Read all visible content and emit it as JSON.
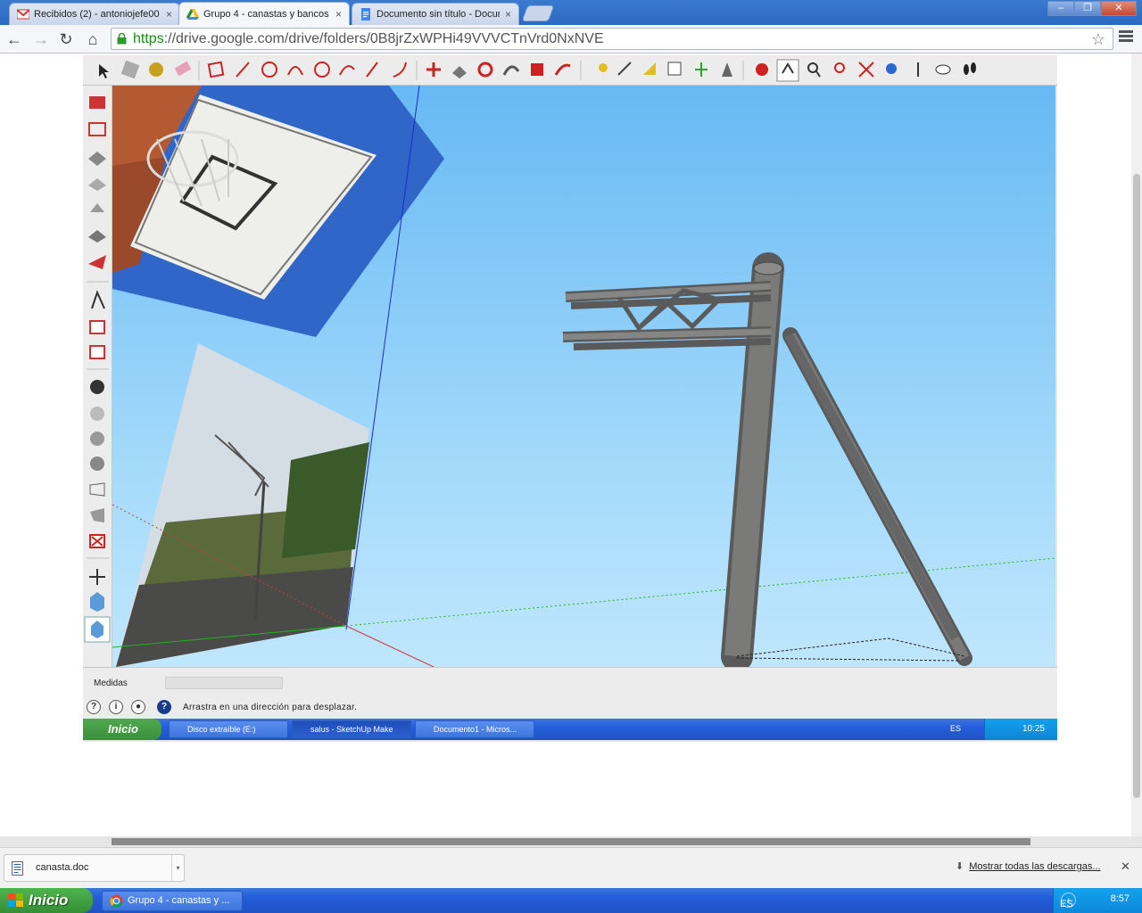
{
  "browser": {
    "tabs": [
      {
        "label": "Recibidos (2) - antoniojefe00",
        "close": "×",
        "icon": "gmail-icon"
      },
      {
        "label": "Grupo 4 - canastas y bancos",
        "close": "×",
        "icon": "google-drive-icon"
      },
      {
        "label": "Documento sin título - Docum",
        "close": "×",
        "icon": "google-docs-icon"
      }
    ],
    "window_buttons": {
      "minimize": "–",
      "maximize": "❐",
      "close": "✕"
    },
    "nav": {
      "back": "←",
      "forward": "→",
      "reload": "↻",
      "home": "⌂"
    },
    "url_scheme": "https",
    "url_rest": "://drive.google.com/drive/folders/0B8jrZxWPHi49VVVCTnVrd0NxNVE",
    "bookmark_star": "☆"
  },
  "sketchup": {
    "measurements_label": "Medidas",
    "measurements_value": "",
    "status_hint": "Arrastra en una dirección para desplazar.",
    "status_icons": [
      "?",
      "i",
      "●",
      "?"
    ],
    "inner_taskbar": {
      "start": "Inicio",
      "buttons": [
        {
          "label": "Disco extraíble (E:)"
        },
        {
          "label": "salus - SketchUp Make"
        },
        {
          "label": "Documento1 - Micros..."
        }
      ],
      "lang": "ES",
      "clock": "10:25"
    }
  },
  "downloads": {
    "item_name": "canasta.doc",
    "show_all": "Mostrar todas las descargas...",
    "close": "✕",
    "arrow": "▾"
  },
  "taskbar": {
    "start": "Inicio",
    "window_button": "Grupo 4 - canastas y ...",
    "lang": "ES",
    "clock": "8:57",
    "tray_arrow": "‹"
  },
  "colors": {
    "sky_top": "#67b9f4",
    "sky_bottom": "#bfe6fc",
    "https_green": "#1a8a1a",
    "xp_blue": "#245edb",
    "xp_green": "#3b8f3b"
  }
}
